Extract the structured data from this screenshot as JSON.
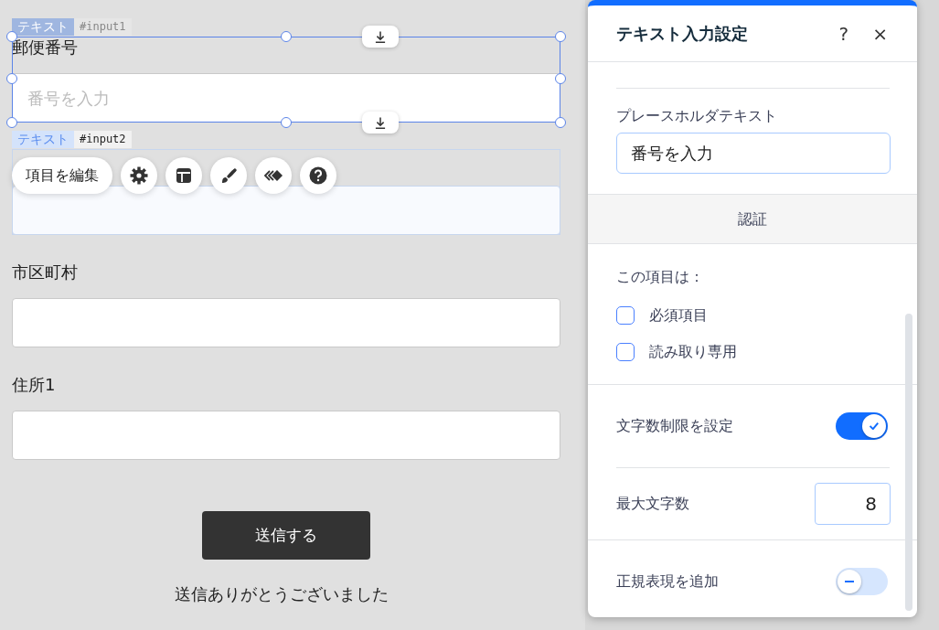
{
  "canvas": {
    "fields": [
      {
        "label": "郵便番号",
        "type_tag": "テキスト",
        "id_tag": "#input1",
        "placeholder": "番号を入力",
        "selected": true
      },
      {
        "type_tag": "テキスト",
        "id_tag": "#input2",
        "selected": false
      },
      {
        "label": "市区町村",
        "selected": false
      },
      {
        "label": "住所1",
        "selected": false
      }
    ],
    "submit_button": "送信する",
    "success_message": "送信ありがとうございました"
  },
  "toolbar": {
    "edit_button": "項目を編集"
  },
  "panel": {
    "title": "テキスト入力設定",
    "help": "?",
    "close": "×",
    "placeholder_field": {
      "label": "プレースホルダテキスト",
      "value": "番号を入力"
    },
    "section": "認証",
    "checks_label": "この項目は：",
    "checkboxes": [
      {
        "label": "必須項目",
        "checked": false
      },
      {
        "label": "読み取り専用",
        "checked": false
      }
    ],
    "char_limit": {
      "label": "文字数制限を設定",
      "on": true
    },
    "max_chars": {
      "label": "最大文字数",
      "value": "8"
    },
    "regex": {
      "label": "正規表現を追加",
      "on": false
    }
  }
}
